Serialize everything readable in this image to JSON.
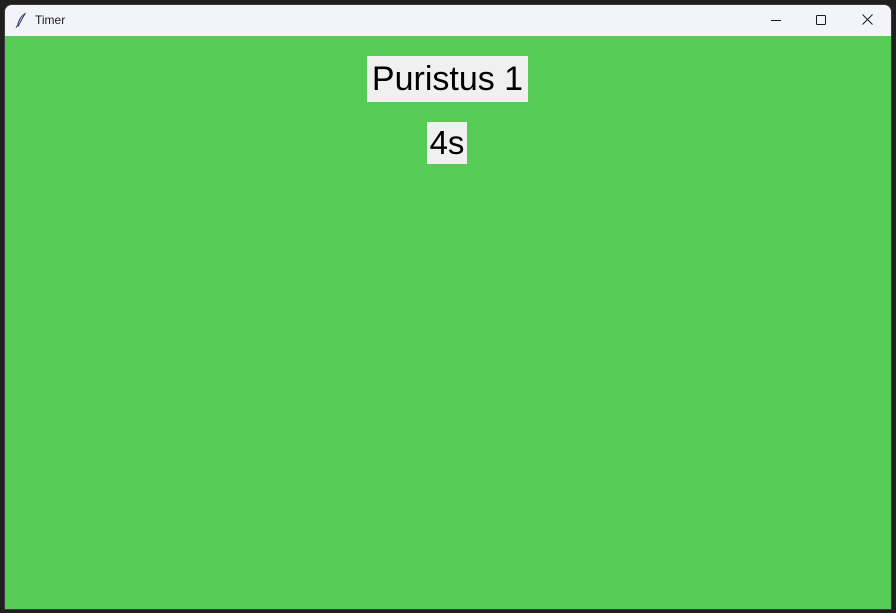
{
  "window": {
    "title": "Timer",
    "app_icon": "feather-icon",
    "controls": [
      "minimize-icon",
      "maximize-icon",
      "close-icon"
    ]
  },
  "colors": {
    "background": "#56cc56",
    "label_background": "#f0f0f0",
    "titlebar": "#f3f4f8"
  },
  "timer": {
    "phase": "Puristus 1",
    "remaining": "4s"
  }
}
